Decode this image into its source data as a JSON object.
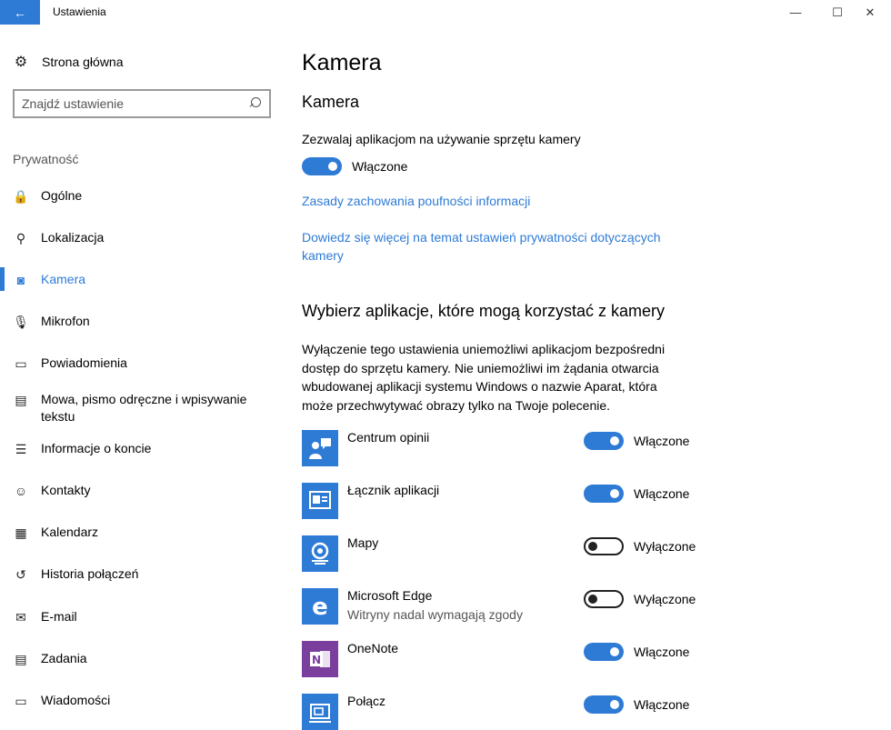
{
  "window": {
    "title": "Ustawienia",
    "back_glyph": "←",
    "minimize_glyph": "—",
    "maximize_glyph": "☐",
    "close_glyph": "✕"
  },
  "sidebar": {
    "home_label": "Strona główna",
    "search_placeholder": "Znajdź ustawienie",
    "section_label": "Prywatność",
    "items": [
      {
        "label": "Ogólne",
        "icon": "lock-icon",
        "glyph": "🔒"
      },
      {
        "label": "Lokalizacja",
        "icon": "location-person-icon",
        "glyph": "⚲"
      },
      {
        "label": "Kamera",
        "icon": "camera-icon",
        "glyph": "◙"
      },
      {
        "label": "Mikrofon",
        "icon": "microphone-icon",
        "glyph": "🎙"
      },
      {
        "label": "Powiadomienia",
        "icon": "notification-icon",
        "glyph": "▭"
      },
      {
        "label": "Mowa, pismo odręczne i wpisywanie tekstu",
        "icon": "clipboard-icon",
        "glyph": "▤"
      },
      {
        "label": "Informacje o koncie",
        "icon": "account-info-icon",
        "glyph": "☰"
      },
      {
        "label": "Kontakty",
        "icon": "contacts-icon",
        "glyph": "☺"
      },
      {
        "label": "Kalendarz",
        "icon": "calendar-icon",
        "glyph": "▦"
      },
      {
        "label": "Historia połączeń",
        "icon": "history-icon",
        "glyph": "↺"
      },
      {
        "label": "E-mail",
        "icon": "mail-icon",
        "glyph": "✉"
      },
      {
        "label": "Zadania",
        "icon": "tasks-icon",
        "glyph": "▤"
      },
      {
        "label": "Wiadomości",
        "icon": "message-icon",
        "glyph": "▭"
      }
    ],
    "active_item": "Kamera"
  },
  "main": {
    "page_title": "Kamera",
    "sub_title": "Kamera",
    "allow_label": "Zezwalaj aplikacjom na używanie sprzętu kamery",
    "allow_state": "Włączone",
    "link_privacy": "Zasady zachowania poufności informacji",
    "link_learn_more": "Dowiedz się więcej na temat ustawień prywatności dotyczących kamery",
    "apps_section_title": "Wybierz aplikacje, które mogą korzystać z kamery",
    "apps_description": "Wyłączenie tego ustawienia uniemożliwi aplikacjom bezpośredni dostęp do sprzętu kamery. Nie uniemożliwi im żądania otwarcia wbudowanej aplikacji systemu Windows o nazwie Aparat, która może przechwytywać obrazy tylko na Twoje polecenie.",
    "apps": [
      {
        "name": "Centrum opinii",
        "subtitle": "",
        "state": "Włączone",
        "on": true,
        "icon": "feedback-hub-icon",
        "color": "#2e7bd6"
      },
      {
        "name": "Łącznik aplikacji",
        "subtitle": "",
        "state": "Włączone",
        "on": true,
        "icon": "app-connector-icon",
        "color": "#2e7bd6"
      },
      {
        "name": "Mapy",
        "subtitle": "",
        "state": "Wyłączone",
        "on": false,
        "icon": "maps-icon",
        "color": "#2e7bd6"
      },
      {
        "name": "Microsoft Edge",
        "subtitle": "Witryny nadal wymagają zgody",
        "state": "Wyłączone",
        "on": false,
        "icon": "edge-icon",
        "color": "#2e7bd6"
      },
      {
        "name": "OneNote",
        "subtitle": "",
        "state": "Włączone",
        "on": true,
        "icon": "onenote-icon",
        "color": "#7a3e9d"
      },
      {
        "name": "Połącz",
        "subtitle": "",
        "state": "Włączone",
        "on": true,
        "icon": "connect-icon",
        "color": "#2e7bd6"
      }
    ]
  },
  "colors": {
    "accent": "#2e7bd6",
    "onenote": "#7a3e9d"
  }
}
